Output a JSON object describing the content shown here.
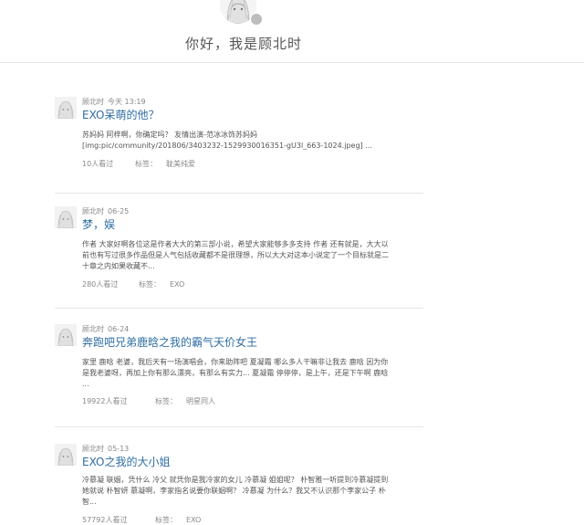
{
  "header": {
    "greeting": "你好，我是顾北时"
  },
  "posts": [
    {
      "author": "顾北时",
      "time": "今天 13:19",
      "title": "EXO呆萌的他？",
      "excerpt": [
        "苏妈妈 阿梓啊，你确定吗？ 友情出演-范冰冰饰苏妈妈",
        "[img:pic/community/201806/3403232-1529930016351-gU3l_663-1024.jpeg] ..."
      ],
      "views": "10人看过",
      "tag_label": "标签：",
      "tag": "耽美纯爱"
    },
    {
      "author": "顾北时",
      "time": "06-25",
      "title": "梦，娱",
      "excerpt": [
        "作者 大家好啊各位这是作者大大的第三部小说，希望大家能够多多支持 作者 还有就是，大大以",
        "前也有写过很多作品但是人气包括收藏都不是很理想，所以大大对这本小说定了一个目标就是二",
        "十章之内如果收藏不..."
      ],
      "views": "280人看过",
      "tag_label": "标签：",
      "tag": "EXO"
    },
    {
      "author": "顾北时",
      "time": "06-24",
      "title": "奔跑吧兄弟鹿晗之我的霸气天价女王",
      "excerpt": [
        "家里 鹿晗 老婆，我后天有一场演唱会，你来助阵吧 夏凝霜 哪么多人干嘛非让我去 鹿晗 因为你",
        "是我老婆呀，再加上你有那么漂亮，有那么有实力... 夏凝霜 停停停，是上午，还是下午啊 鹿晗",
        "..."
      ],
      "views": "19922人看过",
      "tag_label": "标签：",
      "tag": "明星同人"
    },
    {
      "author": "顾北时",
      "time": "05-13",
      "title": "EXO之我的大小姐",
      "excerpt": [
        "冷慕凝 联姻，凭什么 冷父 就凭你是我冷家的女儿 冷慕凝 姐姐呢？ 朴智雅一听提到冷慕凝提到",
        "她就说 朴智妍 慕凝啊，李家指名说要你联姻啊？ 冷慕凝 为什么？我又不认识那个李家公子 朴",
        "智..."
      ],
      "views": "57792人看过",
      "tag_label": "标签：",
      "tag": "EXO"
    }
  ]
}
